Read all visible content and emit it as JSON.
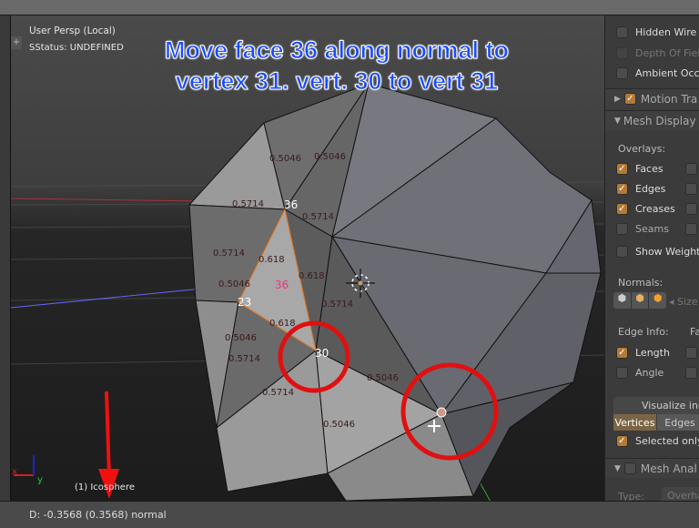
{
  "viewport": {
    "view_name": "User Persp (Local)",
    "status": "SStatus: UNDEFINED",
    "object_label": "(1) Icosphere",
    "annotation": [
      "Move face 36 along normal to",
      "vertex 31. vert. 30 to vert 31"
    ],
    "annotation_color": "#1a4cff",
    "vertex_labels": [
      "36",
      "23",
      "30"
    ],
    "face_label": "36",
    "edge_lengths": [
      "0.5046",
      "0.5046",
      "0.5714",
      "0.5714",
      "0.5714",
      "0.618",
      "0.618",
      "0.5046",
      "0.5714",
      "0.618",
      "0.5046",
      "0.5714",
      "0.5714",
      "0.5046",
      "0.5046"
    ],
    "axis_labels": {
      "x": "x",
      "y": "y"
    }
  },
  "panel": {
    "display_items": [
      {
        "label": "Hidden Wire",
        "checked": false
      },
      {
        "label": "Depth Of Field",
        "checked": false,
        "disabled": true
      },
      {
        "label": "Ambient Occlu",
        "checked": false
      }
    ],
    "motion_tracking": {
      "label": "Motion Tra",
      "checked": true
    },
    "mesh_display": {
      "title": "Mesh Display",
      "overlays_label": "Overlays:",
      "overlays": [
        {
          "label": "Faces",
          "checked": true
        },
        {
          "label": "Edges",
          "checked": true
        },
        {
          "label": "Creases",
          "checked": true
        },
        {
          "label": "Seams",
          "checked": false
        },
        {
          "label": "Show Weights",
          "checked": false
        }
      ],
      "normals_label": "Normals:",
      "size_label": "Size",
      "edge_info_label": "Edge Info:",
      "face_info_label": "Fa",
      "edge_info": [
        {
          "label": "Length",
          "checked": true
        },
        {
          "label": "Angle",
          "checked": false
        }
      ],
      "visualize_label": "Visualize indi",
      "visualize_tabs": [
        "Vertices",
        "Edges"
      ],
      "visualize_active": "Vertices",
      "selected_only": {
        "label": "Selected only",
        "checked": true
      }
    },
    "mesh_analysis": {
      "label": "Mesh Anal",
      "checked": false,
      "type_label": "Type:",
      "type_value": "Overha"
    }
  },
  "statusbar": {
    "text": "D: -0.3568 (0.3568) normal"
  },
  "colors": {
    "checkbox_on": "#b57a38",
    "selection_edge": "#e07a2a",
    "circle_marker": "#e01010"
  }
}
